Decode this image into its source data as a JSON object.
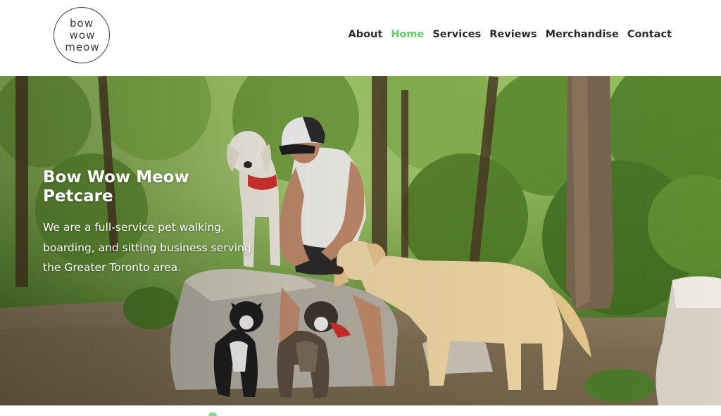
{
  "logo": {
    "line1": "bow",
    "line2": "wow",
    "line3": "meow"
  },
  "nav": {
    "items": [
      {
        "label": "About",
        "active": false
      },
      {
        "label": "Home",
        "active": true
      },
      {
        "label": "Services",
        "active": false
      },
      {
        "label": "Reviews",
        "active": false
      },
      {
        "label": "Merchandise",
        "active": false
      },
      {
        "label": "Contact",
        "active": false
      }
    ],
    "active_color": "#5fd068",
    "text_color": "#2b2b2b"
  },
  "hero": {
    "title": "Bow Wow Meow Petcare",
    "description": "We are a full-service pet walking, boarding, and sitting business serving the Greater Toronto area.",
    "image": "photo of woman in white trucker cap sitting on rock with golden retrievers and two boston terrier mix dogs in a green forest"
  }
}
